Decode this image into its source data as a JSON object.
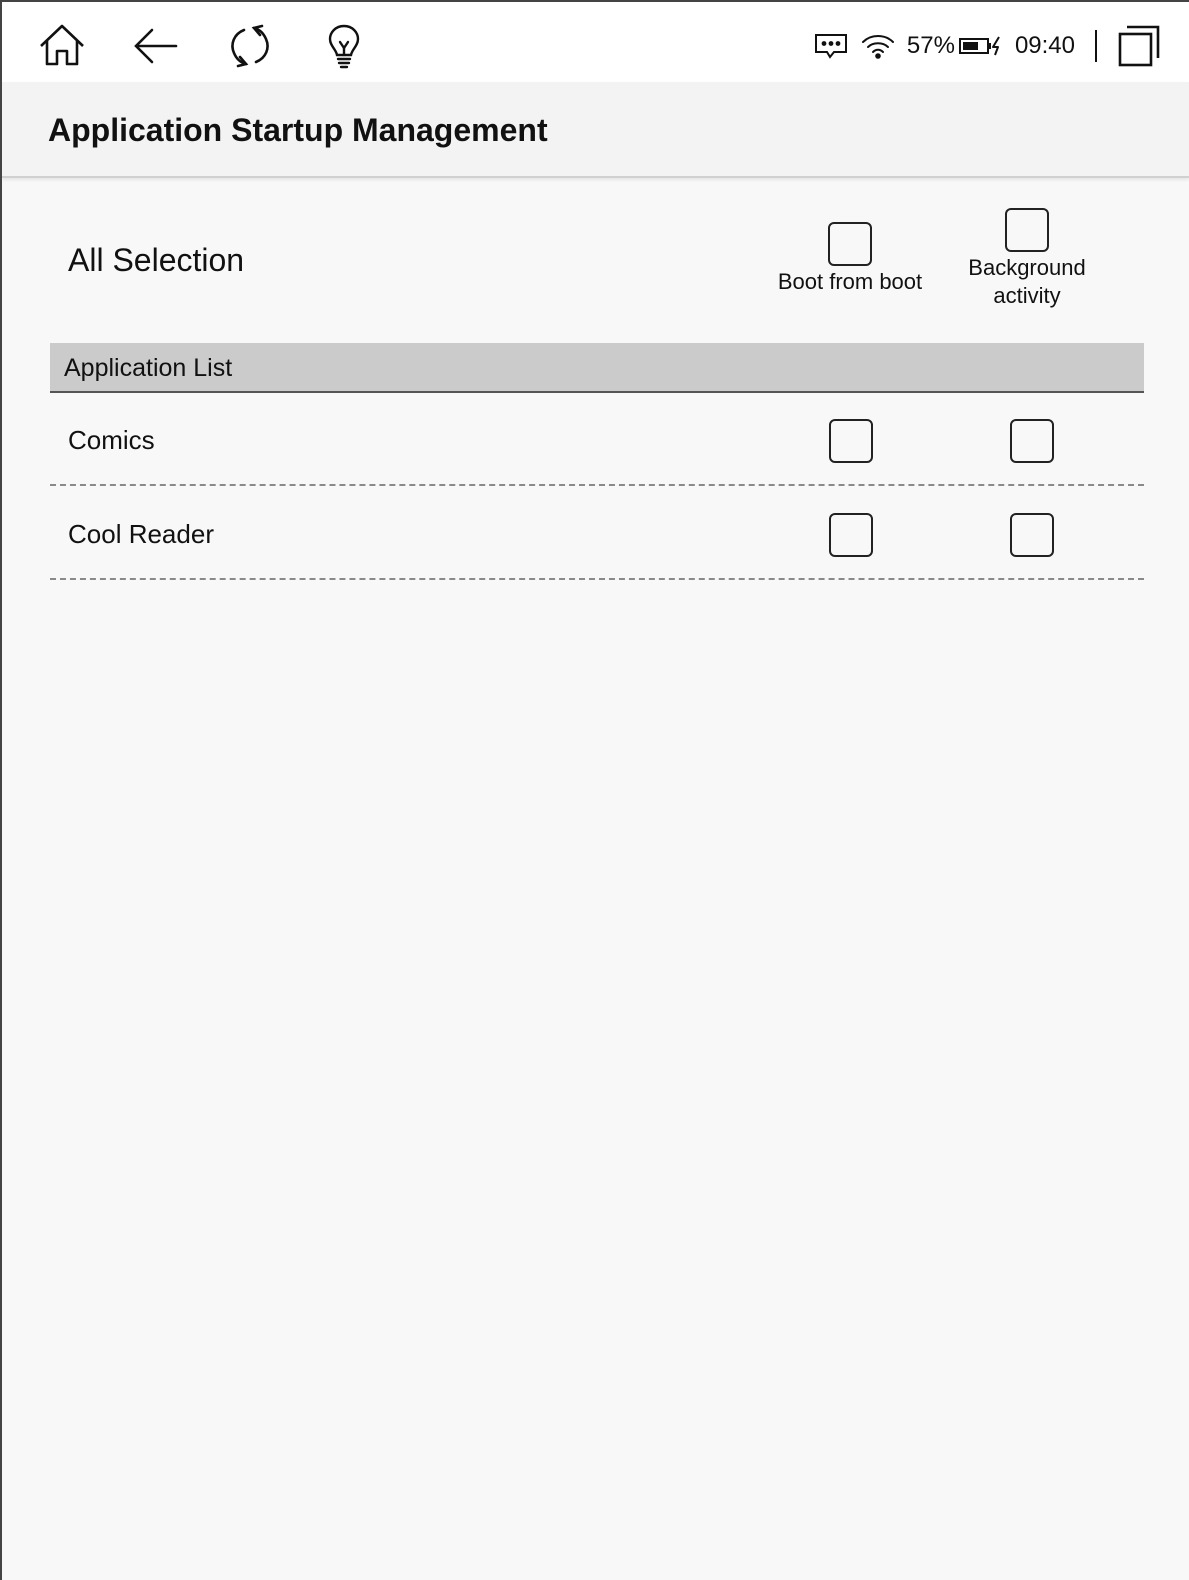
{
  "status_bar": {
    "battery_percent": "57%",
    "time": "09:40",
    "icons": [
      "message-icon",
      "wifi-icon",
      "battery-charging-icon",
      "recent-apps-icon"
    ]
  },
  "nav": {
    "icons": [
      "home-icon",
      "back-icon",
      "refresh-icon",
      "lightbulb-icon"
    ]
  },
  "header": {
    "title": "Application Startup Management"
  },
  "all_selection": {
    "label": "All Selection",
    "columns": [
      {
        "label": "Boot from boot",
        "checked": false
      },
      {
        "label": "Background\nactivity",
        "checked": false
      }
    ]
  },
  "list": {
    "header": "Application List",
    "apps": [
      {
        "name": "Comics",
        "boot": false,
        "background": false
      },
      {
        "name": "Cool Reader",
        "boot": false,
        "background": false
      }
    ]
  }
}
